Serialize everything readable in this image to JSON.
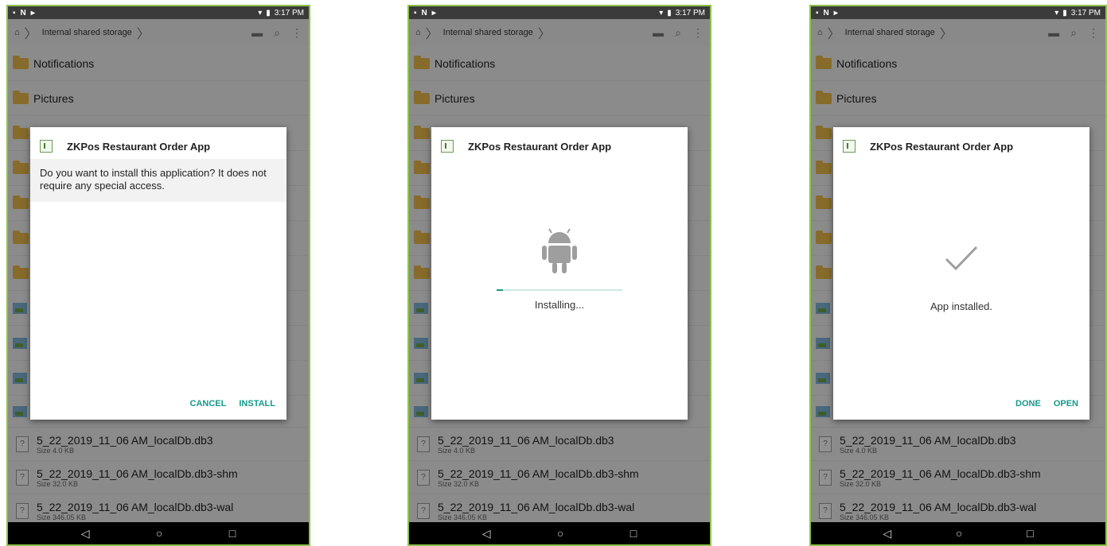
{
  "status_bar": {
    "left_icons": [
      "notification-icon",
      "n-icon",
      "play-icon"
    ],
    "time": "3:17 PM"
  },
  "toolbar": {
    "breadcrumb": "Internal shared storage"
  },
  "folders": [
    "Notifications",
    "Pictures"
  ],
  "files": [
    {
      "name": "5_22_2019_11_06 AM_localDb.db3",
      "size": "Size 4.0 KB"
    },
    {
      "name": "5_22_2019_11_06 AM_localDb.db3-shm",
      "size": "Size 32.0 KB"
    },
    {
      "name": "5_22_2019_11_06 AM_localDb.db3-wal",
      "size": "Size 346.05 KB"
    }
  ],
  "screens": [
    {
      "dialog_title": "ZKPos Restaurant Order App",
      "message": "Do you want to install this application? It does not require any special access.",
      "actions": [
        "CANCEL",
        "INSTALL"
      ]
    },
    {
      "dialog_title": "ZKPos Restaurant Order App",
      "status": "Installing...",
      "progress": 0.05
    },
    {
      "dialog_title": "ZKPos Restaurant Order App",
      "status": "App installed.",
      "actions": [
        "DONE",
        "OPEN"
      ]
    }
  ],
  "colors": {
    "accent": "#17998c",
    "frame": "#8cc34a",
    "folder": "#e8b84a"
  }
}
